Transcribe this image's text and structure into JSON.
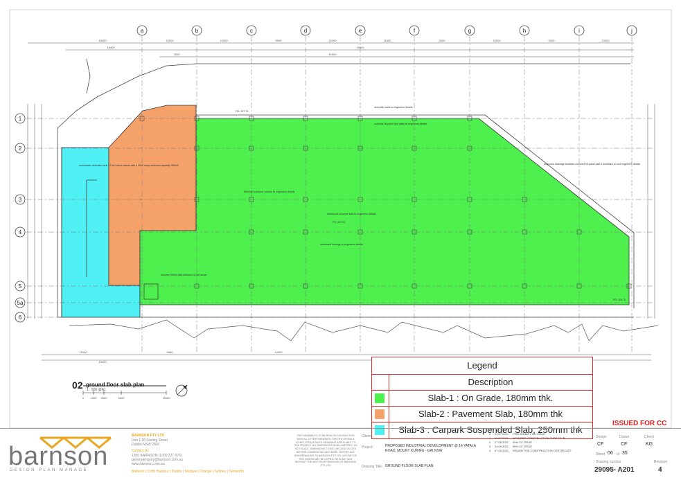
{
  "plan": {
    "grid_columns": [
      "a",
      "b",
      "c",
      "d",
      "e",
      "f",
      "g",
      "h",
      "i",
      "j"
    ],
    "grid_rows": [
      "1",
      "2",
      "3",
      "4",
      "5",
      "5a",
      "6"
    ],
    "notes": {
      "n_top_right": "demolish walls to engineers details",
      "n_top_right2": "concrete tilt panel dec walls to engineers details",
      "n_drainage": "proposed drainage between concrete tilt panel wall & dishdrain to civil engineers details",
      "n_column": "890x380 concrete column to engineers details",
      "n_slab": "reinforced concrete slab to engineers details",
      "n_footing": "reinforced footings to engineers details",
      "n_left": "stormwater detention tank 17,5m below datum with a 2000 deep minimum capacity 350m3",
      "n_thickness": "denotes 50mm slab setdown to wet areas",
      "rl1": "FFL 207.75",
      "rl2": "FFL 207.75",
      "rl3": "FFL 206.75",
      "rl4": "LTD FFL 208.90"
    },
    "dims": {
      "top1": "18400",
      "top2": "10000",
      "top3": "12000",
      "top4": "9000",
      "top5": "10000",
      "top6": "11800",
      "top7": "5000",
      "top8": "10000",
      "top9": "5000",
      "top10": "10000",
      "top11": "10000",
      "top12": "18400",
      "top13": "3500",
      "top14": "10000",
      "bot1": "10000",
      "bot2": "18400",
      "bot3": "9960",
      "bot4": "10000",
      "bot5": "35000"
    }
  },
  "plan_title": {
    "number": "02",
    "title": "ground floor slab plan",
    "scale": "1 : 500 @A1",
    "scale_ticks": [
      "0",
      "1000",
      "3000",
      "5000",
      "10000"
    ]
  },
  "legend": {
    "title": "Legend",
    "header": "Description",
    "items": [
      {
        "color": "#4ef04e",
        "label": "Slab-1 : On Grade, 180mm thk."
      },
      {
        "color": "#f4a26a",
        "label": "Slab-2 : Pavement Slab, 180mm thk"
      },
      {
        "color": "#4ef0f4",
        "label": "Slab-3 : Carpark Suspended Slab, 250mm thk"
      }
    ]
  },
  "status": "ISSUED FOR CC",
  "title_block": {
    "logo_text": "barnson",
    "tagline": "DESIGN PLAN MANAGE",
    "company": "BARNSON PTY LTD",
    "address1": "Unit 1/36 Darling Street",
    "address2": "Dubbo NSW 2830",
    "contact_head": "Contact Us",
    "phone": "1300 BARNSON (1300 227 676)",
    "email": "generalenquiry@barnson.com.au",
    "web": "www.barnson.com.au",
    "offices": "Bathurst | Coffs Harbour | Dubbo | Mudgee | Orange | Sydney | Tamworth",
    "disclaimer": "THIS DRAWING IS TO BE READ IN CONJUNCTION WITH ALL OTHER DRAWINGS, SPECIFICATIONS & OTHER CONSULTANTS DRAWINGS APPLICABLE TO THIS PROJECT. ALL DIMENSIONS IN MILLIMETRES. DO NOT SCALE. DIMENSIONS TO BE CHECKED ON SITE BEFORE COMMENCING ANY WORK. REPORT ANY DISCREPANCIES TO BARNSON PTY LTD. NO PART OF THIS DESIGN MAY BE COPIED OR IN ANY WAY WITHOUT THE WRITTEN PERMISSION OF BARNSON PTY LTD",
    "client_label": "Client:",
    "project_label": "Project:",
    "project_line1": "PROPOSED INDUSTRIAL DEVELOPMENT @ 14 YATALA",
    "project_line2": "ROAD, MOUNT KURING - GAI NSW",
    "drawing_title_label": "Drawing Title:",
    "drawing_title": "GROUND FLOOR SLAB PLAN",
    "revisions": [
      {
        "rev": "0",
        "date": "23.07.2021",
        "desc": "PRELIMINARY CC ISSUE"
      },
      {
        "rev": "1",
        "date": "18.07.2021",
        "desc": "MODIFIED CONSTRUCTION TYPE TO 'B'"
      },
      {
        "rev": "2",
        "date": "27.08.2021",
        "desc": "90% CC ISSUE"
      },
      {
        "rev": "3",
        "date": "13.09.2021",
        "desc": "95% CC ISSUE"
      },
      {
        "rev": "4",
        "date": "17.09.2021",
        "desc": "ISSUED FOR CONSTRUCTION CERTIFICATE"
      }
    ],
    "design_label": "Design",
    "drawn_label": "Drawn",
    "check_label": "Check",
    "design": "CF",
    "drawn": "CF",
    "check": "KG",
    "sheet_label": "Sheet",
    "sheet": "06",
    "of_label": "of",
    "sheet_total": "35",
    "drawing_number_label": "Drawing number",
    "revision_label": "Revision",
    "drawing_number": "29095- A201",
    "revision": "4"
  },
  "colors": {
    "slab1": "#4ef04e",
    "slab2": "#f4a26a",
    "slab3": "#4ef0f4",
    "accent": "#e02020",
    "brand": "#e8a623"
  }
}
